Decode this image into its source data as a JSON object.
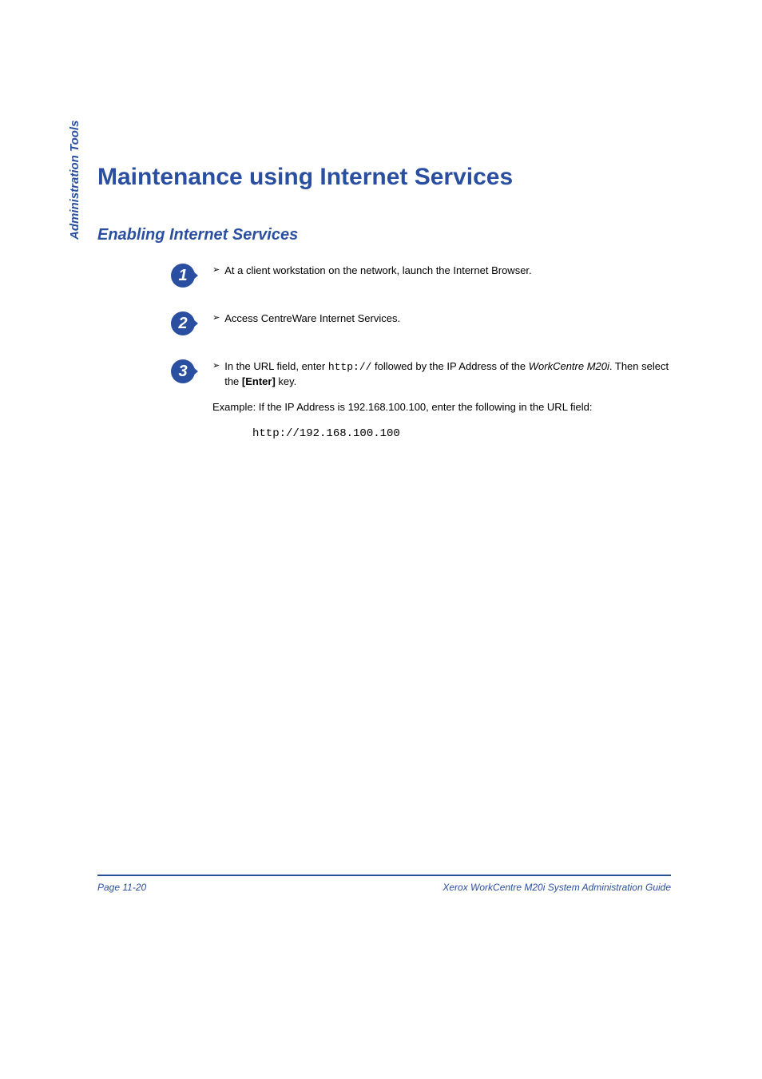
{
  "sidebar_label": "Administration Tools",
  "main_title": "Maintenance using Internet Services",
  "section_title": "Enabling Internet Services",
  "steps": {
    "s1": {
      "num": "1",
      "text": "At a client workstation on the network, launch the Internet Browser."
    },
    "s2": {
      "num": "2",
      "text": "Access CentreWare Internet Services."
    },
    "s3": {
      "num": "3",
      "prefix": "In the URL field, enter ",
      "code": "http://",
      "mid": " followed by the IP Address of the ",
      "product": "WorkCentre M20i",
      "aftermid": ". Then select the ",
      "enter": "[Enter]",
      "suffix": " key.",
      "example": "Example: If the IP Address is 192.168.100.100, enter the following in the URL field:",
      "url": "http://192.168.100.100"
    }
  },
  "footer": {
    "left": "Page 11-20",
    "right": "Xerox WorkCentre M20i System Administration Guide"
  }
}
